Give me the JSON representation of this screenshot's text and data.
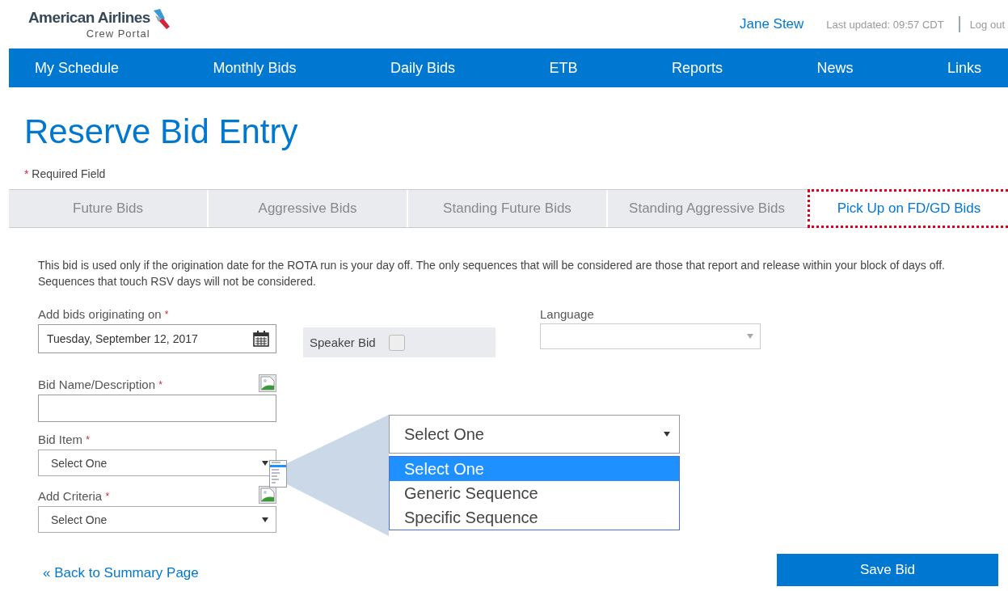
{
  "header": {
    "logo_title": "American Airlines",
    "logo_subtitle": "Crew Portal",
    "user": "Jane Stew",
    "last_updated": "Last updated: 09:57 CDT",
    "logout": "Log out"
  },
  "nav": [
    "My Schedule",
    "Monthly Bids",
    "Daily Bids",
    "ETB",
    "Reports",
    "News",
    "Links"
  ],
  "page_title": "Reserve Bid Entry",
  "required_note": {
    "mark": "*",
    "text": "Required Field"
  },
  "tabs": [
    {
      "label": "Future Bids",
      "selected": false
    },
    {
      "label": "Aggressive Bids",
      "selected": false
    },
    {
      "label": "Standing Future Bids",
      "selected": false
    },
    {
      "label": "Standing Aggressive Bids",
      "selected": false
    },
    {
      "label": "Pick Up on FD/GD Bids",
      "selected": true
    }
  ],
  "description": "This bid is used only if the origination date for the ROTA run is your day off. The only sequences that will be considered are those that report and release within your block of days off. Sequences that touch RSV days will not be considered.",
  "date_field": {
    "label": "Add bids originating on",
    "required_mark": "*",
    "value": "Tuesday, September 12, 2017"
  },
  "speaker_bid": {
    "label": "Speaker Bid",
    "checked": false
  },
  "language": {
    "label": "Language"
  },
  "bid_name": {
    "label": "Bid Name/Description",
    "required_mark": "*"
  },
  "bid_item": {
    "label": "Bid Item",
    "required_mark": "*",
    "value": "Select One"
  },
  "add_criteria": {
    "label": "Add Criteria",
    "required_mark": "*",
    "value": "Select One"
  },
  "callout": {
    "value": "Select One",
    "options": [
      {
        "label": "Select One",
        "selected": true
      },
      {
        "label": "Generic Sequence",
        "selected": false
      },
      {
        "label": "Specific Sequence",
        "selected": false
      }
    ]
  },
  "back_link": "« Back to Summary Page",
  "save_button": "Save Bid"
}
